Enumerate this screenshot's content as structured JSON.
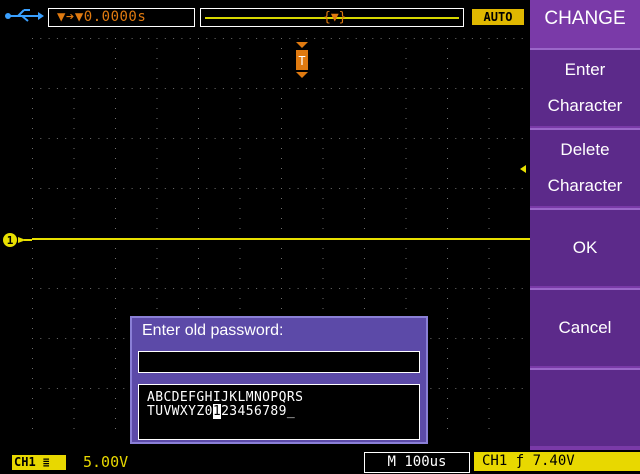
{
  "status": {
    "trigger_position": "▼➔▼0.0000s",
    "trigger_mode": "AUTO"
  },
  "menu": {
    "title": "CHANGE",
    "items": [
      {
        "line1": "Enter",
        "line2": "Character"
      },
      {
        "line1": "Delete",
        "line2": "Character"
      },
      {
        "line1": "OK",
        "line2": ""
      },
      {
        "line1": "Cancel",
        "line2": ""
      },
      {
        "line1": "",
        "line2": ""
      }
    ]
  },
  "dialog": {
    "title": "Enter old password:",
    "input_value": "",
    "keys_row1": "ABCDEFGHIJKLMNOPQRS",
    "keys_row2_before": "TUVWXYZ0",
    "keys_row2_selected": "1",
    "keys_row2_after": "23456789_"
  },
  "bottom": {
    "channel_label": "CH1",
    "channel_scale": "5.00V",
    "timebase": "M 100us",
    "trigger_info": "CH1 ƒ 7.40V"
  },
  "colors": {
    "trace": "#e8e000",
    "grid": "#6e6e6e",
    "menu": "#7a3aa8",
    "trigger_marker": "#e07a10"
  },
  "icons": [
    "usb-icon",
    "trigger-marker-icon",
    "ch1-ground-marker",
    "trigger-level-arrow"
  ]
}
